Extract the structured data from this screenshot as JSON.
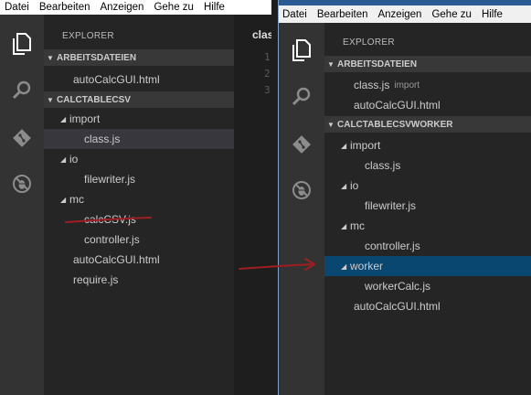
{
  "menu": [
    "Datei",
    "Bearbeiten",
    "Anzeigen",
    "Gehe zu",
    "Hilfe"
  ],
  "explorer_title": "EXPLORER",
  "left_window": {
    "open_editors_header": "ARBEITSDATEIEN",
    "open_editors": [
      {
        "label": "autoCalcGUI.html"
      }
    ],
    "project_header": "CALCTABLECSV",
    "tree": [
      {
        "label": "import",
        "type": "folder"
      },
      {
        "label": "class.js",
        "type": "file",
        "selected": true
      },
      {
        "label": "io",
        "type": "folder"
      },
      {
        "label": "filewriter.js",
        "type": "file"
      },
      {
        "label": "mc",
        "type": "folder"
      },
      {
        "label": "calcCSV.js",
        "type": "file",
        "struck": true
      },
      {
        "label": "controller.js",
        "type": "file"
      },
      {
        "label": "autoCalcGUI.html",
        "type": "file"
      },
      {
        "label": "require.js",
        "type": "file"
      }
    ],
    "editor_tab": "clas",
    "line_numbers": [
      "1",
      "2",
      "3"
    ]
  },
  "right_window": {
    "open_editors_header": "ARBEITSDATEIEN",
    "open_editors": [
      {
        "label": "class.js",
        "hint": "import"
      },
      {
        "label": "autoCalcGUI.html",
        "hint": ""
      }
    ],
    "project_header": "CALCTABLECSVWORKER",
    "tree": [
      {
        "label": "import",
        "type": "folder"
      },
      {
        "label": "class.js",
        "type": "file"
      },
      {
        "label": "io",
        "type": "folder"
      },
      {
        "label": "filewriter.js",
        "type": "file"
      },
      {
        "label": "mc",
        "type": "folder"
      },
      {
        "label": "controller.js",
        "type": "file"
      },
      {
        "label": "worker",
        "type": "folder",
        "focused": true
      },
      {
        "label": "workerCalc.js",
        "type": "file"
      },
      {
        "label": "autoCalcGUI.html",
        "type": "file"
      }
    ]
  },
  "activity_icons": [
    "files-icon",
    "search-icon",
    "git-icon",
    "debug-icon"
  ],
  "annotation_color": "#a01d22"
}
